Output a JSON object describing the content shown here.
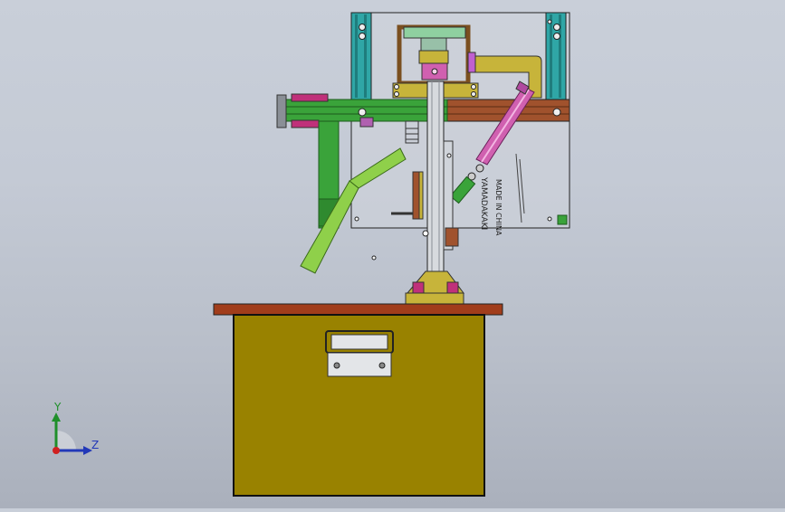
{
  "viewport": {
    "background_top": "#c9cfd9",
    "background_bottom": "#aab0bc"
  },
  "model": {
    "nameplate_text": "YAMADAKAKI",
    "made_in_text": "MADE IN CHINA",
    "colors": {
      "cabinet": "#998200",
      "tabletop": "#a13d1b",
      "frame_green": "#3aa33a",
      "cylinder_pink": "#d060b0",
      "arm_brown": "#a0522d",
      "rail_teal": "#2fa6a6",
      "bracket_olive": "#c7b43a",
      "magenta_part": "#c0307a"
    }
  },
  "triad": {
    "y_label": "Y",
    "z_label": "Z",
    "y_color": "#1f8f2a",
    "z_color": "#2238b8",
    "origin_color": "#d02020"
  }
}
